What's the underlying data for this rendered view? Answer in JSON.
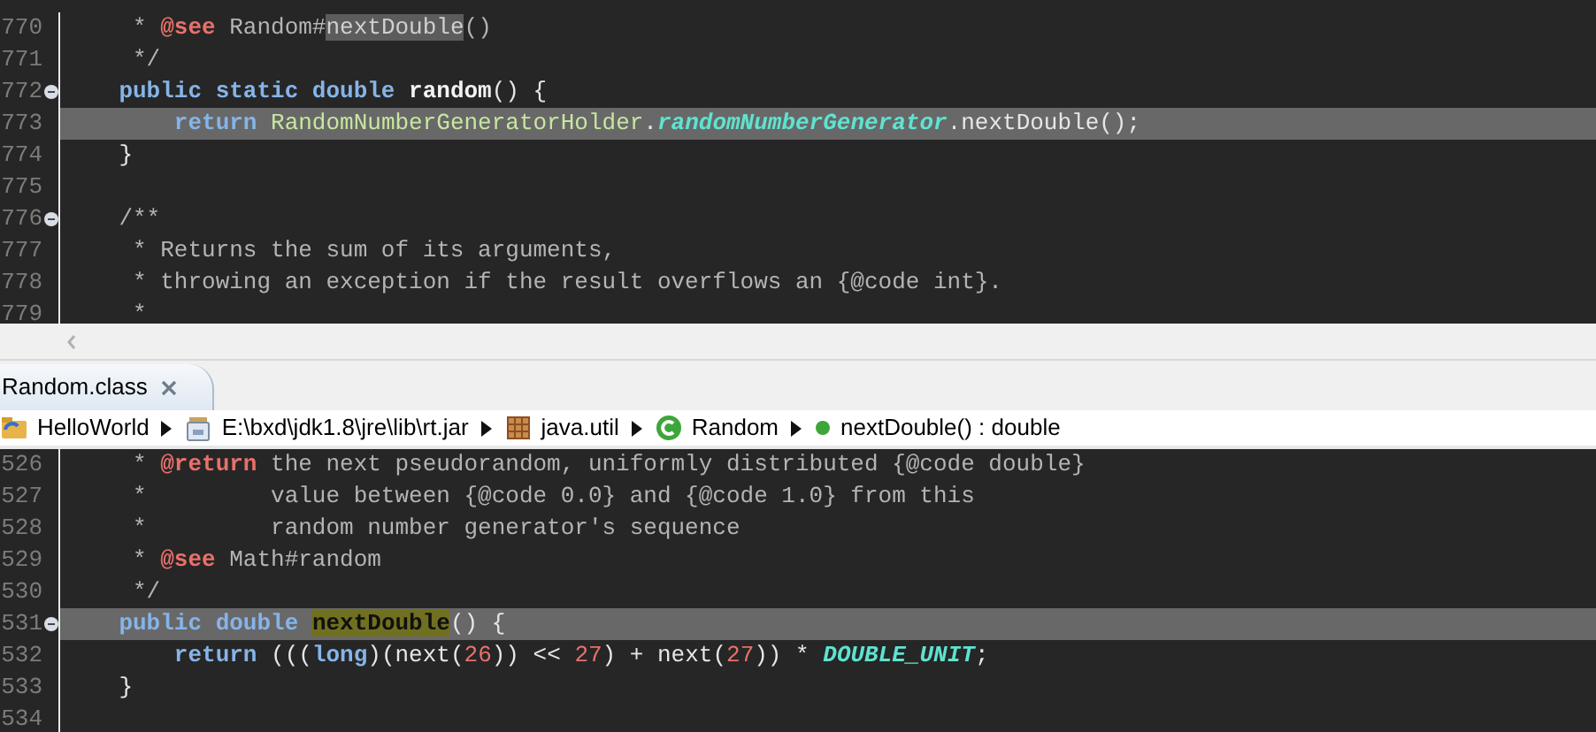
{
  "top_editor": {
    "lines": [
      {
        "number": "770",
        "current": false,
        "foldable": false,
        "tokens": [
          {
            "t": "     * ",
            "kind": "comment"
          },
          {
            "t": "@see",
            "kind": "tag"
          },
          {
            "t": " Random#",
            "kind": "comment"
          },
          {
            "t": "nextDouble",
            "kind": "occurrence"
          },
          {
            "t": "()",
            "kind": "comment"
          }
        ]
      },
      {
        "number": "771",
        "current": false,
        "foldable": false,
        "tokens": [
          {
            "t": "     */",
            "kind": "comment"
          }
        ]
      },
      {
        "number": "772",
        "current": false,
        "foldable": true,
        "tokens": [
          {
            "t": "    public static double ",
            "kind": "keyword"
          },
          {
            "t": "random",
            "kind": "method"
          },
          {
            "t": "() {",
            "kind": "plain"
          }
        ]
      },
      {
        "number": "773",
        "current": true,
        "foldable": false,
        "tokens": [
          {
            "t": "        return ",
            "kind": "keyword"
          },
          {
            "t": "RandomNumberGeneratorHolder",
            "kind": "class"
          },
          {
            "t": ".",
            "kind": "plain"
          },
          {
            "t": "randomNumberGenerator",
            "kind": "static"
          },
          {
            "t": ".nextDouble();",
            "kind": "plain"
          }
        ]
      },
      {
        "number": "774",
        "current": false,
        "foldable": false,
        "tokens": [
          {
            "t": "    }",
            "kind": "plain"
          }
        ]
      },
      {
        "number": "775",
        "current": false,
        "foldable": false
      },
      {
        "number": "776",
        "current": false,
        "foldable": true,
        "tokens": [
          {
            "t": "    /**",
            "kind": "comment"
          }
        ]
      },
      {
        "number": "777",
        "current": false,
        "foldable": false,
        "tokens": [
          {
            "t": "     * Returns the sum of its arguments,",
            "kind": "comment"
          }
        ]
      },
      {
        "number": "778",
        "current": false,
        "foldable": false,
        "tokens": [
          {
            "t": "     * throwing an exception if the result overflows an {@code int}.",
            "kind": "comment"
          }
        ]
      },
      {
        "number": "779",
        "current": false,
        "foldable": false,
        "tokens": [
          {
            "t": "     *",
            "kind": "comment"
          }
        ]
      }
    ]
  },
  "tab": {
    "label": "Random.class"
  },
  "breadcrumb": [
    {
      "kind": "project",
      "label": "HelloWorld"
    },
    {
      "kind": "jar",
      "label": "E:\\bxd\\jdk1.8\\jre\\lib\\rt.jar"
    },
    {
      "kind": "package",
      "label": "java.util"
    },
    {
      "kind": "class",
      "label": "Random"
    },
    {
      "kind": "method",
      "label": "nextDouble() : double"
    }
  ],
  "bottom_editor": {
    "lines": [
      {
        "number": "526",
        "current": false,
        "foldable": false,
        "tokens": [
          {
            "t": "     * ",
            "kind": "comment"
          },
          {
            "t": "@return",
            "kind": "tag"
          },
          {
            "t": " the next pseudorandom, uniformly distributed {@code double}",
            "kind": "comment"
          }
        ]
      },
      {
        "number": "527",
        "current": false,
        "foldable": false,
        "tokens": [
          {
            "t": "     *         value between {@code 0.0} and {@code 1.0} from this",
            "kind": "comment"
          }
        ]
      },
      {
        "number": "528",
        "current": false,
        "foldable": false,
        "tokens": [
          {
            "t": "     *         random number generator's sequence",
            "kind": "comment"
          }
        ]
      },
      {
        "number": "529",
        "current": false,
        "foldable": false,
        "tokens": [
          {
            "t": "     * ",
            "kind": "comment"
          },
          {
            "t": "@see",
            "kind": "tag"
          },
          {
            "t": " Math#random",
            "kind": "comment"
          }
        ]
      },
      {
        "number": "530",
        "current": false,
        "foldable": false,
        "tokens": [
          {
            "t": "     */",
            "kind": "comment"
          }
        ]
      },
      {
        "number": "531",
        "current": true,
        "foldable": true,
        "tokens": [
          {
            "t": "    public double ",
            "kind": "keyword"
          },
          {
            "t": "nextDouble",
            "kind": "method-occurrence"
          },
          {
            "t": "() {",
            "kind": "plain"
          }
        ]
      },
      {
        "number": "532",
        "current": false,
        "foldable": false,
        "tokens": [
          {
            "t": "        return",
            "kind": "keyword"
          },
          {
            "t": " (((",
            "kind": "plain"
          },
          {
            "t": "long",
            "kind": "keyword"
          },
          {
            "t": ")(next(",
            "kind": "plain"
          },
          {
            "t": "26",
            "kind": "number"
          },
          {
            "t": ")) << ",
            "kind": "plain"
          },
          {
            "t": "27",
            "kind": "number"
          },
          {
            "t": ") + next(",
            "kind": "plain"
          },
          {
            "t": "27",
            "kind": "number"
          },
          {
            "t": ")) * ",
            "kind": "plain"
          },
          {
            "t": "DOUBLE_UNIT",
            "kind": "static"
          },
          {
            "t": ";",
            "kind": "plain"
          }
        ]
      },
      {
        "number": "533",
        "current": false,
        "foldable": false,
        "tokens": [
          {
            "t": "    }",
            "kind": "plain"
          }
        ]
      },
      {
        "number": "534",
        "current": false,
        "foldable": false
      }
    ]
  }
}
